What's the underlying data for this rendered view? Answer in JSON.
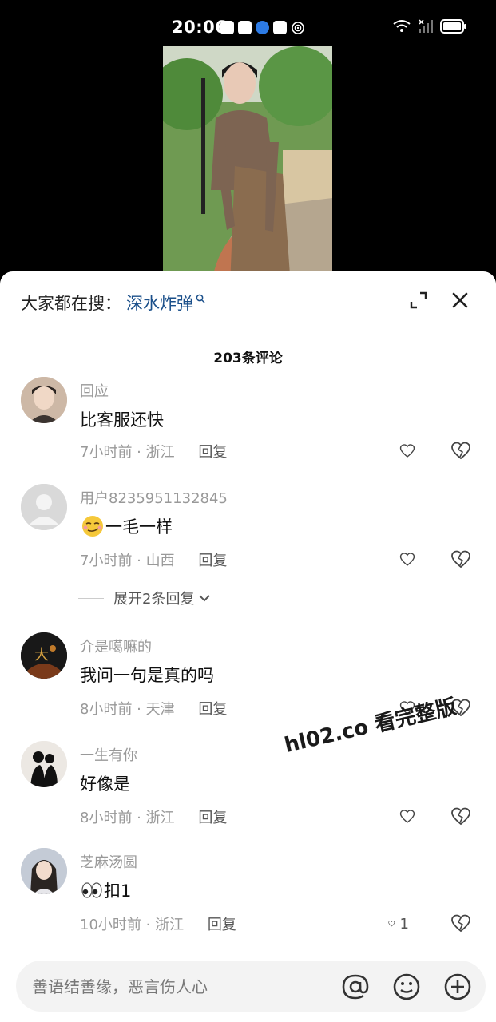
{
  "status_bar": {
    "time": "20:06",
    "icons": [
      "app-icon",
      "app-icon",
      "browser-icon",
      "app-icon",
      "hotspot-icon",
      "wifi-icon",
      "signal-icon",
      "battery-icon"
    ]
  },
  "video": {
    "icon": "video-thumbnail"
  },
  "header": {
    "search_label": "大家都在搜：",
    "search_term": "深水炸弹",
    "expand_icon": "expand-icon",
    "close_icon": "close-icon"
  },
  "comment_count": "203条评论",
  "comments": [
    {
      "user": "回应",
      "text": "比客服还快",
      "time": "7小时前 · 浙江",
      "reply": "回复",
      "likes": "",
      "avatar": "avatar-photo"
    },
    {
      "user": "用户8235951132845",
      "text": "一毛一样",
      "emoji": "smirk-emoji",
      "time": "7小时前 · 山西",
      "reply": "回复",
      "likes": "",
      "avatar": "default-avatar"
    },
    {
      "user": "介是噶嘛的",
      "text": "我问一句是真的吗",
      "time": "8小时前 · 天津",
      "reply": "回复",
      "likes": "",
      "avatar": "avatar-photo"
    },
    {
      "user": "一生有你",
      "text": "好像是",
      "time": "8小时前 · 浙江",
      "reply": "回复",
      "likes": "",
      "avatar": "avatar-photo"
    },
    {
      "user": "芝麻汤圆",
      "text": "扣1",
      "emoji": "eyes-emoji",
      "time": "10小时前 · 浙江",
      "reply": "回复",
      "likes": "1",
      "avatar": "avatar-photo"
    }
  ],
  "expand_replies": "展开2条回复",
  "watermark": "hl02.co 看完整版",
  "input": {
    "placeholder": "善语结善缘，恶言伤人心",
    "icons": [
      "at-icon",
      "emoji-icon",
      "add-icon"
    ]
  },
  "colors": {
    "accent_link": "#1a4f8a",
    "meta_gray": "#999999",
    "sheet_bg": "#ffffff"
  }
}
